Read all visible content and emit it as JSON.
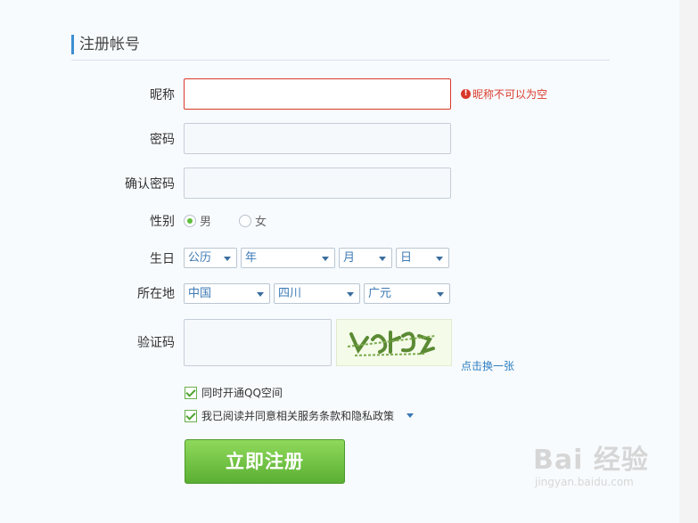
{
  "form": {
    "title": "注册帐号",
    "nickname": {
      "label": "昵称",
      "value": "",
      "error": "昵称不可以为空"
    },
    "password": {
      "label": "密码",
      "value": ""
    },
    "confirm": {
      "label": "确认密码",
      "value": ""
    },
    "gender": {
      "label": "性别",
      "options": [
        "男",
        "女"
      ],
      "selected": "男"
    },
    "birthday": {
      "label": "生日",
      "calendar": "公历",
      "year": "年",
      "month": "月",
      "day": "日"
    },
    "location": {
      "label": "所在地",
      "country": "中国",
      "province": "四川",
      "city": "广元"
    },
    "captcha": {
      "label": "验证码",
      "value": "",
      "refresh": "点击换一张"
    },
    "options": {
      "qzone": {
        "label": "同时开通QQ空间",
        "checked": true
      },
      "agree": {
        "label": "我已阅读并同意相关服务条款和隐私政策",
        "checked": true
      }
    },
    "submit": "立即注册"
  },
  "watermark": {
    "top": "Bai  经验",
    "bottom": "jingyan.baidu.com"
  },
  "colors": {
    "error": "#d8382b",
    "accent": "#3d8fd1",
    "button": "#5aaf32"
  }
}
